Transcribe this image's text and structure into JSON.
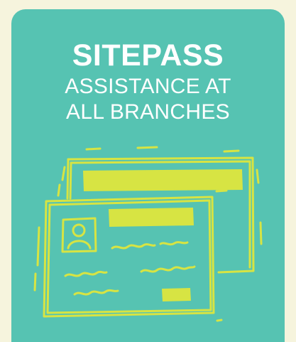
{
  "card": {
    "title": "SITEPASS",
    "subtitle_line1": "ASSISTANCE AT",
    "subtitle_line2": "ALL BRANCHES"
  },
  "illustration": {
    "icon": "id-cards-icon",
    "colors": {
      "stroke": "#d7e443",
      "fill": "#d7e443",
      "background": "#56c3b2"
    }
  },
  "colors": {
    "page_background": "#f6f4dd",
    "card_background": "#56c3b2",
    "text": "#ffffff"
  }
}
